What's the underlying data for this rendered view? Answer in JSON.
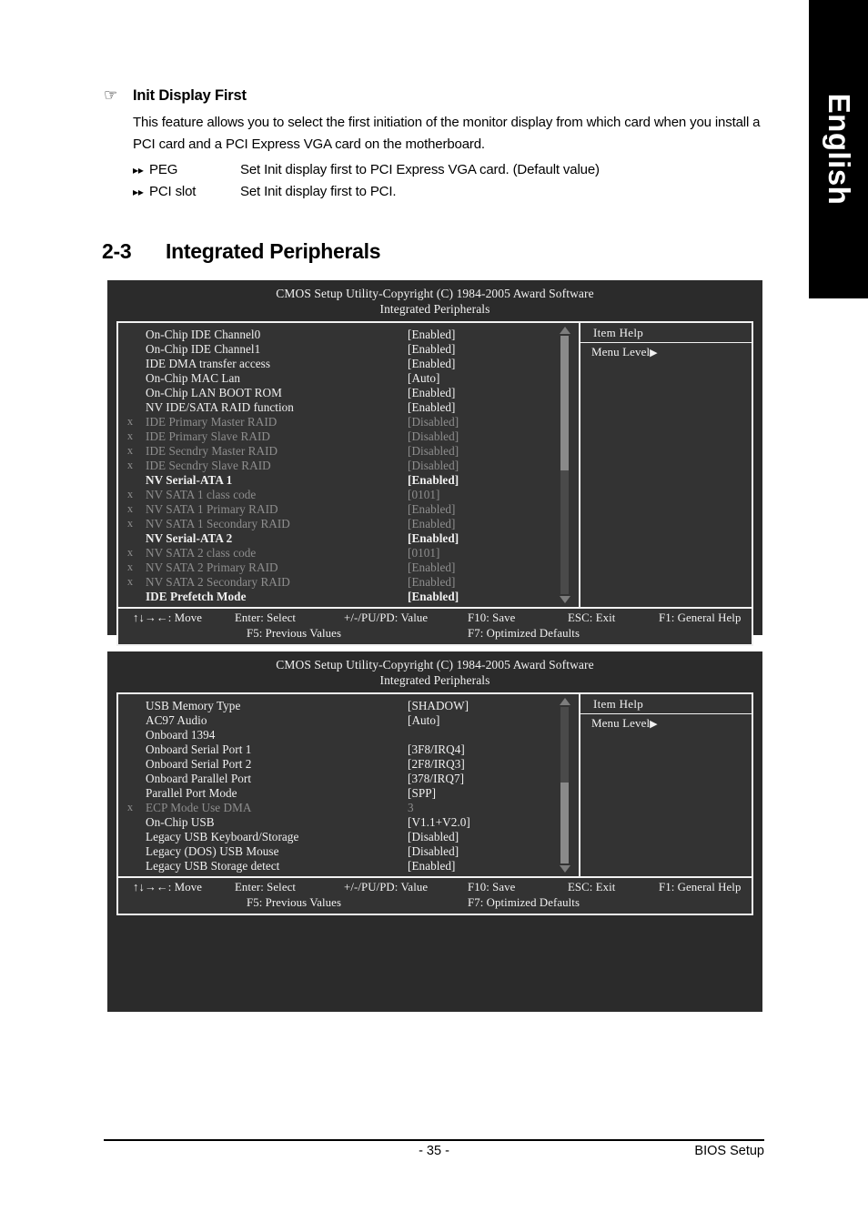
{
  "language_tab": {
    "label": "English"
  },
  "feature": {
    "icon": "pointing-hand-icon",
    "title": "Init Display First",
    "description": "This feature allows you to select the first initiation of the monitor display from which card when you install a PCI card and a PCI Express VGA card on the motherboard.",
    "options": [
      {
        "bullet": "▸▸",
        "name": "PEG",
        "desc": "Set Init display first to PCI Express VGA card. (Default value)"
      },
      {
        "bullet": "▸▸",
        "name": "PCI slot",
        "desc": "Set Init display first to PCI."
      }
    ]
  },
  "section": {
    "number": "2-3",
    "title": "Integrated Peripherals"
  },
  "bios_common": {
    "title": "CMOS Setup Utility-Copyright (C) 1984-2005 Award Software",
    "subtitle": "Integrated Peripherals",
    "help_header": "Item Help",
    "menu_level": "Menu Level",
    "menu_level_caret": "▶",
    "footer": {
      "move": "↑↓→←: Move",
      "enter": "Enter: Select",
      "value": "+/-/PU/PD: Value",
      "save": "F10: Save",
      "exit": "ESC: Exit",
      "help": "F1: General Help",
      "previous": "F5: Previous Values",
      "optimized": "F7: Optimized Defaults"
    }
  },
  "bios_screen_1": {
    "rows": [
      {
        "x": "",
        "label": "On-Chip IDE Channel0",
        "value": "[Enabled]",
        "state": "normal"
      },
      {
        "x": "",
        "label": "On-Chip IDE Channel1",
        "value": "[Enabled]",
        "state": "normal"
      },
      {
        "x": "",
        "label": "IDE DMA transfer access",
        "value": "[Enabled]",
        "state": "normal"
      },
      {
        "x": "",
        "label": "On-Chip MAC Lan",
        "value": "[Auto]",
        "state": "normal"
      },
      {
        "x": "",
        "label": "On-Chip LAN BOOT ROM",
        "value": "[Enabled]",
        "state": "normal"
      },
      {
        "x": "",
        "label": "NV IDE/SATA RAID function",
        "value": "[Enabled]",
        "state": "normal"
      },
      {
        "x": "x",
        "label": "IDE Primary Master RAID",
        "value": "[Disabled]",
        "state": "dim"
      },
      {
        "x": "x",
        "label": "IDE Primary Slave RAID",
        "value": "[Disabled]",
        "state": "dim"
      },
      {
        "x": "x",
        "label": "IDE Secndry Master RAID",
        "value": "[Disabled]",
        "state": "dim"
      },
      {
        "x": "x",
        "label": "IDE Secndry Slave RAID",
        "value": "[Disabled]",
        "state": "dim"
      },
      {
        "x": "",
        "label": "NV Serial-ATA 1",
        "value": "[Enabled]",
        "state": "strong"
      },
      {
        "x": "x",
        "label": "NV SATA 1 class code",
        "value": "[0101]",
        "state": "dim"
      },
      {
        "x": "x",
        "label": "NV SATA 1 Primary RAID",
        "value": "[Enabled]",
        "state": "dim"
      },
      {
        "x": "x",
        "label": "NV SATA 1 Secondary RAID",
        "value": "[Enabled]",
        "state": "dim"
      },
      {
        "x": "",
        "label": "NV Serial-ATA 2",
        "value": "[Enabled]",
        "state": "strong"
      },
      {
        "x": "x",
        "label": "NV SATA 2 class code",
        "value": "[0101]",
        "state": "dim"
      },
      {
        "x": "x",
        "label": "NV SATA 2 Primary RAID",
        "value": "[Enabled]",
        "state": "dim"
      },
      {
        "x": "x",
        "label": "NV SATA 2 Secondary RAID",
        "value": "[Enabled]",
        "state": "dim"
      },
      {
        "x": "",
        "label": "IDE Prefetch Mode",
        "value": "[Enabled]",
        "state": "strong"
      }
    ],
    "scrollbar": {
      "thumb_start_pct": 0,
      "thumb_size_pct": 52
    }
  },
  "bios_screen_2": {
    "rows": [
      {
        "x": "",
        "label": "USB Memory Type",
        "value": "[SHADOW]",
        "state": "normal"
      },
      {
        "x": "",
        "label": "AC97 Audio",
        "value": "[Auto]",
        "state": "normal"
      },
      {
        "x": "",
        "label": "Onboard 1394",
        "value": "",
        "state": "normal"
      },
      {
        "x": "",
        "label": "Onboard Serial Port 1",
        "value": "[3F8/IRQ4]",
        "state": "normal"
      },
      {
        "x": "",
        "label": "Onboard Serial Port 2",
        "value": "[2F8/IRQ3]",
        "state": "normal"
      },
      {
        "x": "",
        "label": "Onboard Parallel Port",
        "value": "[378/IRQ7]",
        "state": "normal"
      },
      {
        "x": "",
        "label": "Parallel Port Mode",
        "value": "[SPP]",
        "state": "normal"
      },
      {
        "x": "x",
        "label": "ECP Mode Use DMA",
        "value": "3",
        "state": "dim"
      },
      {
        "x": "",
        "label": "On-Chip USB",
        "value": "[V1.1+V2.0]",
        "state": "normal"
      },
      {
        "x": "",
        "label": "Legacy USB Keyboard/Storage",
        "value": "[Disabled]",
        "state": "normal"
      },
      {
        "x": "",
        "label": "Legacy (DOS) USB Mouse",
        "value": "[Disabled]",
        "state": "normal"
      },
      {
        "x": "",
        "label": "Legacy USB Storage detect",
        "value": "[Enabled]",
        "state": "normal"
      }
    ],
    "scrollbar": {
      "thumb_start_pct": 48,
      "thumb_size_pct": 52
    }
  },
  "page_footer": {
    "page_number": "- 35 -",
    "chapter": "BIOS Setup"
  }
}
